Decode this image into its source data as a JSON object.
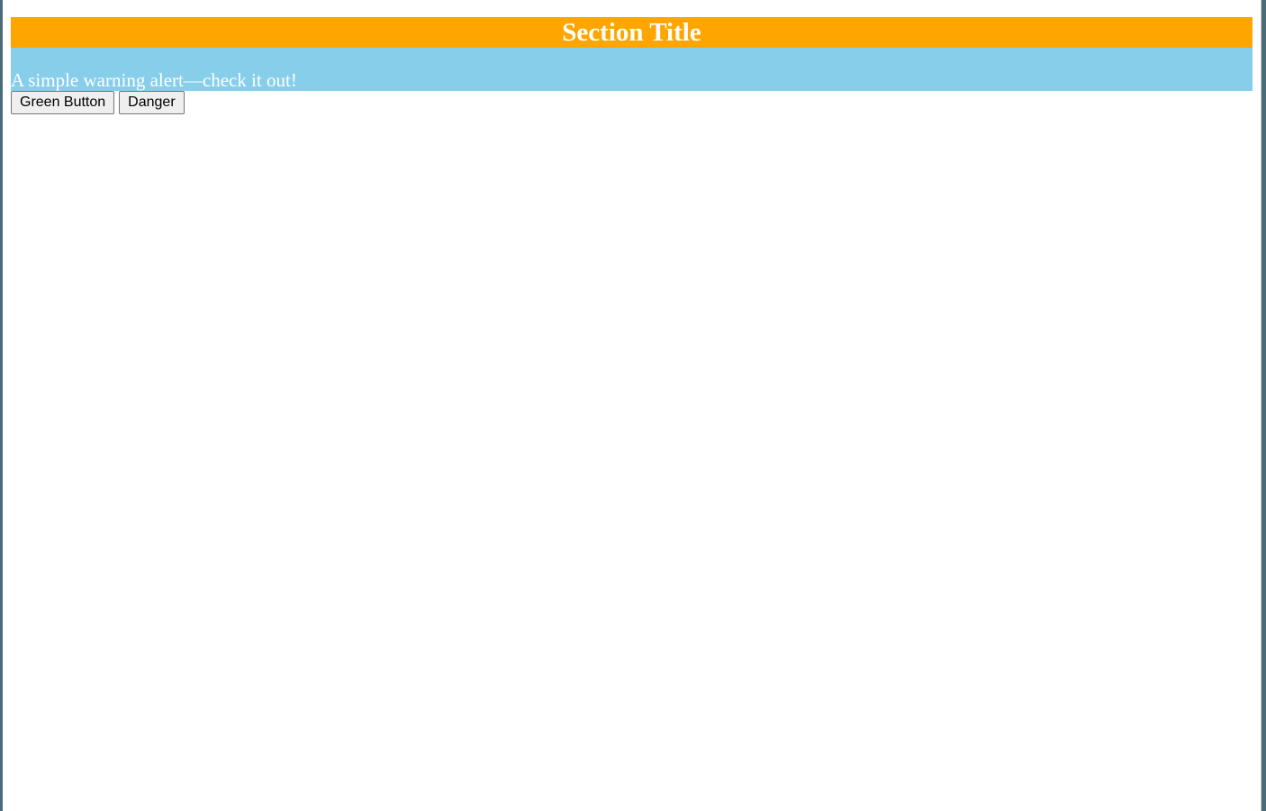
{
  "section": {
    "title": "Section Title"
  },
  "alert": {
    "text": "A simple warning alert—check it out!"
  },
  "buttons": {
    "green_label": "Green Button",
    "danger_label": "Danger"
  },
  "colors": {
    "header_bg": "#ffa500",
    "alert_bg": "#87ceeb",
    "text_on_color": "#ffffff",
    "page_bg": "#ffffff"
  }
}
